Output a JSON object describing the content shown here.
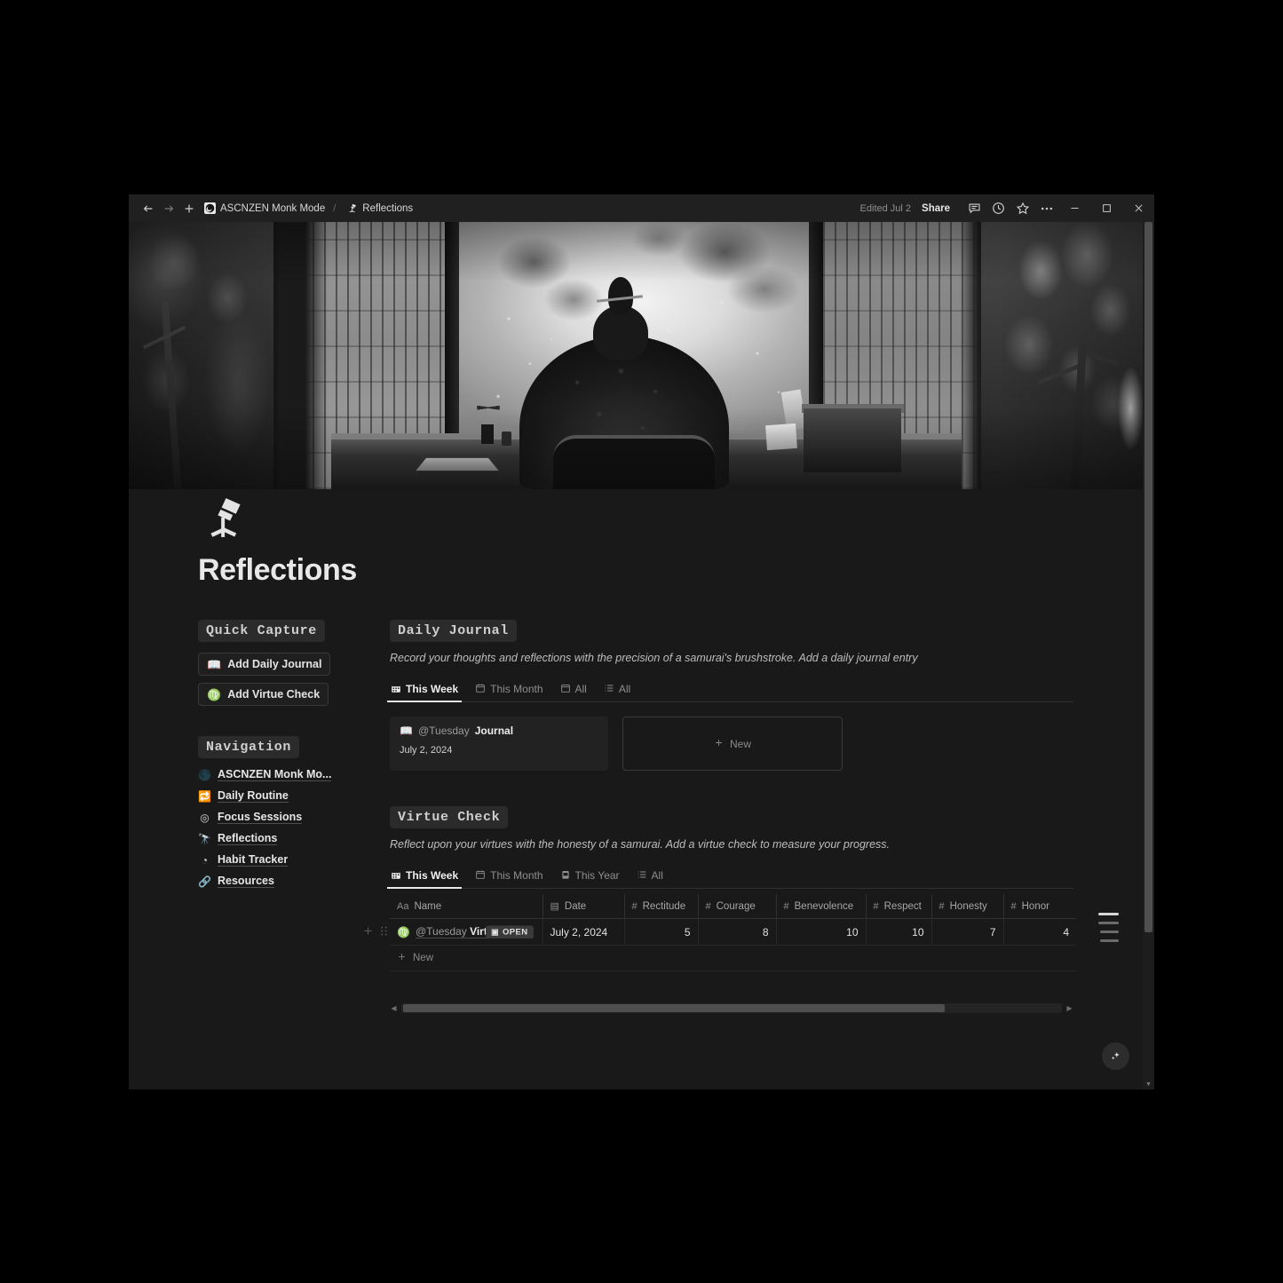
{
  "titlebar": {
    "back_icon": "arrow-left-icon",
    "forward_icon": "arrow-right-icon",
    "new_icon": "plus-icon",
    "workspace_icon": "moon-icon",
    "workspace": "ASCNZEN Monk Mode",
    "separator": "/",
    "page_icon": "telescope-icon",
    "page": "Reflections",
    "edited": "Edited Jul 2",
    "share": "Share",
    "comment_icon": "comment-icon",
    "history_icon": "clock-icon",
    "favorite_icon": "star-icon",
    "more_icon": "ellipsis-icon",
    "minimize": "—",
    "maximize": "□",
    "close": "✕"
  },
  "page": {
    "icon": "telescope-icon",
    "title": "Reflections",
    "toc_label": "table-of-contents"
  },
  "quick_capture": {
    "heading": "Quick Capture",
    "buttons": [
      {
        "icon": "📖",
        "icon_name": "open-book-icon",
        "label": "Add Daily Journal"
      },
      {
        "icon": "♍",
        "icon_name": "virgo-icon",
        "label": "Add Virtue Check"
      }
    ]
  },
  "navigation": {
    "heading": "Navigation",
    "items": [
      {
        "icon": "🌑",
        "icon_name": "moon-icon",
        "label": "ASCNZEN Monk Mo..."
      },
      {
        "icon": "🔁",
        "icon_name": "repeat-icon",
        "label": "Daily Routine"
      },
      {
        "icon": "◎",
        "icon_name": "target-icon",
        "label": "Focus Sessions"
      },
      {
        "icon": "🔭",
        "icon_name": "telescope-icon",
        "label": "Reflections"
      },
      {
        "icon": "◔",
        "icon_name": "chart-icon",
        "label": "Habit Tracker"
      },
      {
        "icon": "🔗",
        "icon_name": "link-icon",
        "label": "Resources"
      }
    ]
  },
  "daily_journal": {
    "heading": "Daily Journal",
    "description": "Record your thoughts and reflections with the precision of a samurai's brushstroke. Add a daily journal entry",
    "tabs": [
      {
        "icon": "🗓",
        "icon_name": "calendar-week-icon",
        "label": "This Week",
        "active": true
      },
      {
        "icon": "🗓",
        "icon_name": "calendar-month-icon",
        "label": "This Month",
        "active": false
      },
      {
        "icon": "🗓",
        "icon_name": "calendar-icon",
        "label": "All",
        "active": false
      },
      {
        "icon": "☰",
        "icon_name": "list-icon",
        "label": "All",
        "active": false
      }
    ],
    "cards": [
      {
        "icon": "📖",
        "icon_name": "open-book-icon",
        "at": "@Tuesday",
        "name": "Journal",
        "date": "July 2, 2024"
      }
    ],
    "new_label": "New",
    "new_icon": "plus-icon"
  },
  "virtue_check": {
    "heading": "Virtue Check",
    "description": "Reflect upon your virtues with the honesty of a samurai. Add a virtue check to measure your progress.",
    "tabs": [
      {
        "icon": "🗓",
        "icon_name": "calendar-week-icon",
        "label": "This Week",
        "active": true
      },
      {
        "icon": "🗓",
        "icon_name": "calendar-month-icon",
        "label": "This Month",
        "active": false
      },
      {
        "icon": "🗓",
        "icon_name": "calendar-year-icon",
        "label": "This Year",
        "active": false
      },
      {
        "icon": "☰",
        "icon_name": "list-icon",
        "label": "All",
        "active": false
      }
    ],
    "table": {
      "columns": [
        {
          "type_icon": "Aa",
          "label": "Name"
        },
        {
          "type_icon": "▤",
          "label": "Date"
        },
        {
          "type_icon": "#",
          "label": "Rectitude"
        },
        {
          "type_icon": "#",
          "label": "Courage"
        },
        {
          "type_icon": "#",
          "label": "Benevolence"
        },
        {
          "type_icon": "#",
          "label": "Respect"
        },
        {
          "type_icon": "#",
          "label": "Honesty"
        },
        {
          "type_icon": "#",
          "label": "Honor"
        }
      ],
      "rows": [
        {
          "page_icon": "♍",
          "page_icon_name": "virgo-icon",
          "name_at": "@Tuesday",
          "name_bold": "Virt",
          "badge": "OPEN",
          "badge_icon": "▣",
          "date": "July 2, 2024",
          "rectitude": "5",
          "courage": "8",
          "benevolence": "10",
          "respect": "10",
          "honesty": "7",
          "honor": "4"
        }
      ],
      "new_label": "New",
      "new_icon": "plus-icon"
    }
  },
  "footer": {
    "ai_button_icon": "sparkles-icon"
  }
}
